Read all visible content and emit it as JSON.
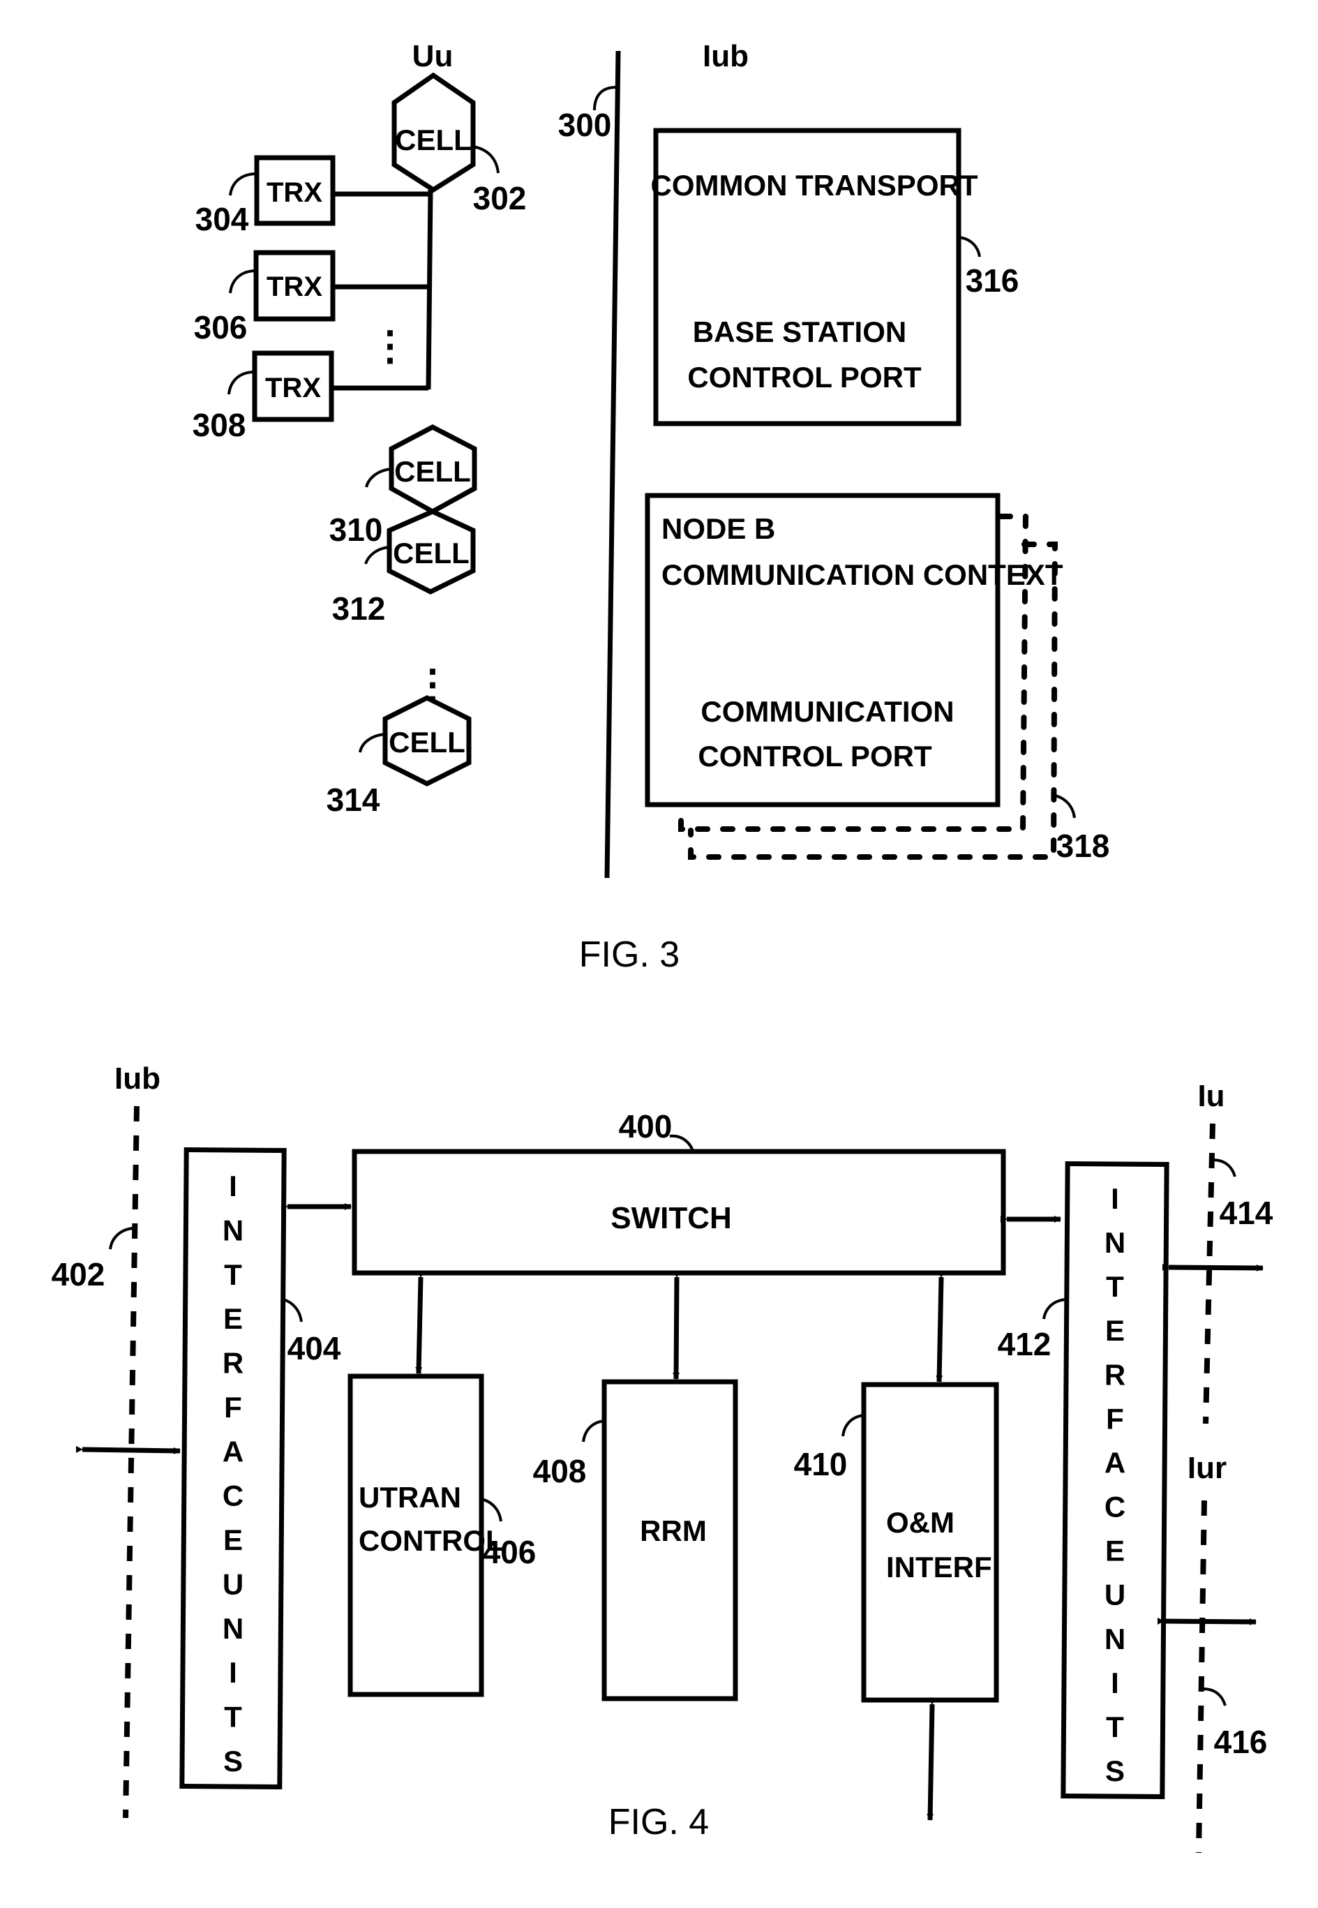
{
  "fig3": {
    "caption": "FIG. 3",
    "interface_uu": "Uu",
    "interface_iub": "Iub",
    "ref_line": "300",
    "cell_label": "CELL",
    "trx_label": "TRX",
    "cells": [
      {
        "ref": "302",
        "label": "CELL"
      },
      {
        "ref": "310",
        "label": "CELL"
      },
      {
        "ref": "312",
        "label": "CELL"
      },
      {
        "ref": "314",
        "label": "CELL"
      }
    ],
    "trx": [
      {
        "ref": "304",
        "label": "TRX"
      },
      {
        "ref": "306",
        "label": "TRX"
      },
      {
        "ref": "308",
        "label": "TRX"
      }
    ],
    "common_transport": {
      "ref": "316",
      "line1": "COMMON TRANSPORT",
      "line2": "BASE STATION",
      "line3": "CONTROL PORT"
    },
    "node_b_context": {
      "ref": "318",
      "line1": "NODE B",
      "line2": "COMMUNICATION CONTEXT",
      "line3": "COMMUNICATION",
      "line4": "CONTROL PORT"
    },
    "ellipsis": "⋮"
  },
  "fig4": {
    "caption": "FIG. 4",
    "interface_iub": "Iub",
    "interface_iu": "Iu",
    "interface_iur": "Iur",
    "switch": {
      "ref": "400",
      "label": "SWITCH"
    },
    "iub_ref": "402",
    "interface_units_left": {
      "ref": "404",
      "letters": [
        "I",
        "N",
        "T",
        "E",
        "R",
        "F",
        "A",
        "C",
        "E",
        "U",
        "N",
        "I",
        "T",
        "S"
      ]
    },
    "utran_control": {
      "ref": "406",
      "line1": "UTRAN",
      "line2": "CONTROL"
    },
    "rrm": {
      "ref": "408",
      "label": "RRM"
    },
    "om_interf": {
      "ref": "410",
      "line1": "O&M",
      "line2": "INTERF"
    },
    "interface_units_right": {
      "ref": "412",
      "letters": [
        "I",
        "N",
        "T",
        "E",
        "R",
        "F",
        "A",
        "C",
        "E",
        "U",
        "N",
        "I",
        "T",
        "S"
      ]
    },
    "iu_ref": "414",
    "iur_ref": "416"
  }
}
